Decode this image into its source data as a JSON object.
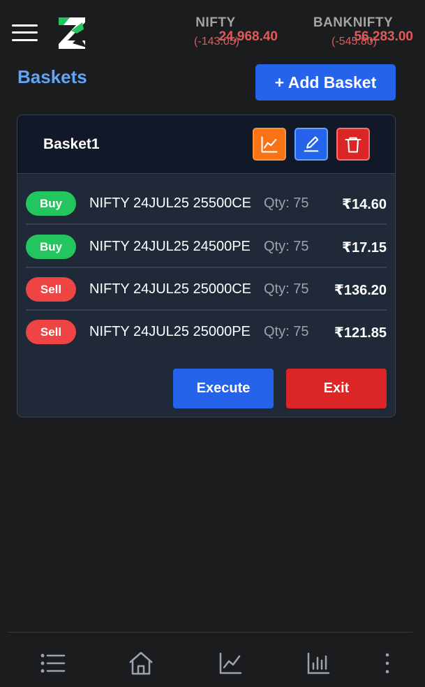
{
  "header": {
    "menu_icon": "hamburger-menu-icon",
    "logo_icon": "z-logo-icon",
    "tickers": [
      {
        "name": "NIFTY",
        "price": "24,968.40",
        "change": "(-143.05)",
        "color": "#e05a5a"
      },
      {
        "name": "BANKNIFTY",
        "price": "56,283.00",
        "change": "(-545.80)",
        "color": "#e05a5a"
      }
    ]
  },
  "page": {
    "title": "Baskets",
    "add_button_label": "+ Add Basket"
  },
  "basket": {
    "name": "Basket1",
    "actions": [
      "chart-icon",
      "edit-icon",
      "trash-icon"
    ],
    "legs": [
      {
        "side": "Buy",
        "symbol": "NIFTY 24JUL25 25500CE",
        "qty": "Qty: 75",
        "price": "₹14.60"
      },
      {
        "side": "Buy",
        "symbol": "NIFTY 24JUL25 24500PE",
        "qty": "Qty: 75",
        "price": "₹17.15"
      },
      {
        "side": "Sell",
        "symbol": "NIFTY 24JUL25 25000CE",
        "qty": "Qty: 75",
        "price": "₹136.20"
      },
      {
        "side": "Sell",
        "symbol": "NIFTY 24JUL25 25000PE",
        "qty": "Qty: 75",
        "price": "₹121.85"
      }
    ],
    "execute_label": "Execute",
    "exit_label": "Exit"
  },
  "bottom_nav": {
    "items": [
      "list-icon",
      "home-icon",
      "line-chart-icon",
      "bar-chart-icon",
      "more-vertical-icon"
    ]
  },
  "colors": {
    "buy": "#22c55e",
    "sell": "#ef4444",
    "accent": "#2563eb",
    "title": "#60a5fa"
  }
}
